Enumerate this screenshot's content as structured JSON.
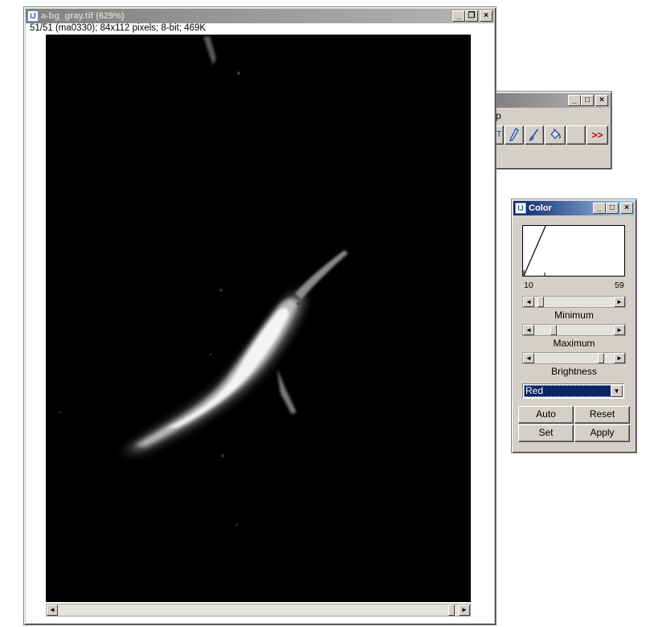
{
  "image_window": {
    "title": "a-bg_gray.tif (629%)",
    "info": "51/51 (ma0330); 84x112 pixels; 8-bit; 469K"
  },
  "toolbar_window": {
    "partial_title": "p",
    "more_label": ">>"
  },
  "color_window": {
    "title": "Color",
    "range_min": "10",
    "range_max": "59",
    "sliders": [
      {
        "label": "Minimum",
        "value": 0.05
      },
      {
        "label": "Maximum",
        "value": 0.3
      },
      {
        "label": "Brightness",
        "value": 0.82
      }
    ],
    "channel_select": {
      "selected": "Red"
    },
    "buttons": {
      "auto": "Auto",
      "reset": "Reset",
      "set": "Set",
      "apply": "Apply"
    }
  }
}
